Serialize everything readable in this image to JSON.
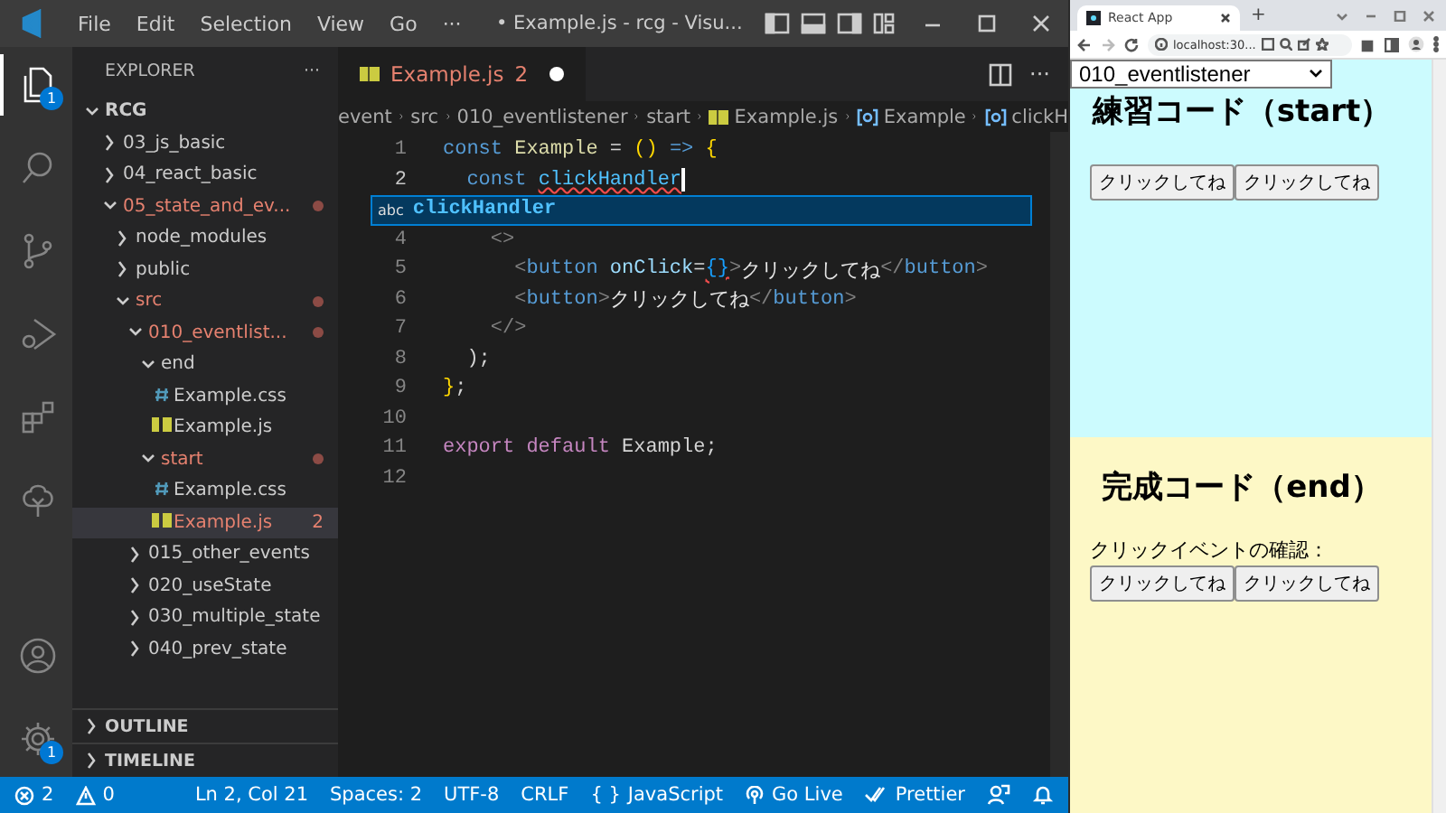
{
  "titlebar": {
    "menu": [
      "File",
      "Edit",
      "Selection",
      "View",
      "Go",
      "···"
    ],
    "title": "• Example.js - rcg - Visu..."
  },
  "activity_bar": {
    "top": [
      {
        "kind": "files",
        "badge": "1",
        "selected": true
      },
      {
        "kind": "search",
        "selected": false
      },
      {
        "kind": "source-control",
        "selected": false
      },
      {
        "kind": "run-debug",
        "selected": false
      },
      {
        "kind": "extensions",
        "selected": false
      },
      {
        "kind": "tree",
        "selected": false
      }
    ],
    "bottom": [
      {
        "kind": "account"
      },
      {
        "kind": "settings",
        "badge": "1"
      }
    ]
  },
  "sidebar": {
    "title": "EXPLORER",
    "more": "···",
    "root": {
      "label": "RCG",
      "expanded": true,
      "children": [
        {
          "label": "03_js_basic",
          "kind": "folder",
          "expanded": false,
          "modified": false,
          "selected": false
        },
        {
          "label": "04_react_basic",
          "kind": "folder",
          "expanded": false,
          "modified": false,
          "selected": false
        },
        {
          "label": "05_state_and_ev...",
          "kind": "folder",
          "expanded": true,
          "modified": true,
          "selected": false,
          "children": [
            {
              "label": "node_modules",
              "kind": "folder",
              "expanded": false,
              "modified": false,
              "selected": false
            },
            {
              "label": "public",
              "kind": "folder",
              "expanded": false,
              "modified": false,
              "selected": false
            },
            {
              "label": "src",
              "kind": "folder",
              "expanded": true,
              "modified": true,
              "selected": false,
              "children": [
                {
                  "label": "010_eventlist...",
                  "kind": "folder",
                  "expanded": true,
                  "modified": true,
                  "selected": false,
                  "children": [
                    {
                      "label": "end",
                      "kind": "folder",
                      "expanded": true,
                      "modified": false,
                      "selected": false,
                      "children": [
                        {
                          "label": "Example.css",
                          "kind": "css",
                          "modified": false,
                          "selected": false
                        },
                        {
                          "label": "Example.js",
                          "kind": "js",
                          "modified": false,
                          "selected": false
                        }
                      ]
                    },
                    {
                      "label": "start",
                      "kind": "folder",
                      "expanded": true,
                      "modified": true,
                      "selected": false,
                      "children": [
                        {
                          "label": "Example.css",
                          "kind": "css",
                          "modified": false,
                          "selected": false
                        },
                        {
                          "label": "Example.js",
                          "kind": "js",
                          "modified": true,
                          "selected": true,
                          "badge": "2"
                        }
                      ]
                    }
                  ]
                },
                {
                  "label": "015_other_events",
                  "kind": "folder",
                  "expanded": false,
                  "modified": false,
                  "selected": false
                },
                {
                  "label": "020_useState",
                  "kind": "folder",
                  "expanded": false,
                  "modified": false,
                  "selected": false
                },
                {
                  "label": "030_multiple_state",
                  "kind": "folder",
                  "expanded": false,
                  "modified": false,
                  "selected": false
                },
                {
                  "label": "040_prev_state",
                  "kind": "folder",
                  "expanded": false,
                  "modified": false,
                  "selected": false
                }
              ]
            }
          ]
        }
      ]
    },
    "sections": [
      {
        "label": "OUTLINE",
        "expanded": false
      },
      {
        "label": "TIMELINE",
        "expanded": false
      }
    ]
  },
  "editor": {
    "tabs": [
      {
        "label": "Example.js",
        "kind": "js",
        "problems": "2",
        "dirty": true,
        "selected": true
      }
    ],
    "more": "···",
    "breadcrumb": [
      {
        "label": "event",
        "kind": "folder"
      },
      {
        "label": "src",
        "kind": "folder"
      },
      {
        "label": "010_eventlistener",
        "kind": "folder"
      },
      {
        "label": "start",
        "kind": "folder"
      },
      {
        "label": "Example.js",
        "kind": "js"
      },
      {
        "label": "Example",
        "kind": "symbol"
      },
      {
        "label": "clickH",
        "kind": "symbol"
      }
    ],
    "lines": [
      {
        "number": "1",
        "current": false,
        "tokens": [
          {
            "text": "const ",
            "kind": "kw"
          },
          {
            "text": "Example",
            "kind": "fn"
          },
          {
            "text": " = ",
            "kind": "op"
          },
          {
            "text": "()",
            "kind": "brace"
          },
          {
            "text": " => ",
            "kind": "kw"
          },
          {
            "text": "{",
            "kind": "brace"
          }
        ]
      },
      {
        "number": "2",
        "current": true,
        "cursor": true,
        "tokens": [
          {
            "text": "  const ",
            "kind": "kw"
          },
          {
            "text": "clickHandler",
            "kind": "var",
            "error": true
          }
        ]
      },
      {
        "number": "4",
        "current": false,
        "tokens": [
          {
            "text": "    <>",
            "kind": "punct"
          }
        ]
      },
      {
        "number": "5",
        "current": false,
        "tokens": [
          {
            "text": "      <",
            "kind": "punct"
          },
          {
            "text": "button",
            "kind": "kw"
          },
          {
            "text": " onClick",
            "kind": "attr"
          },
          {
            "text": "=",
            "kind": "op"
          },
          {
            "text": "{}",
            "kind": "jsx",
            "error": true
          },
          {
            "text": ">",
            "kind": "punct"
          },
          {
            "text": "クリックしてね",
            "kind": "text"
          },
          {
            "text": "</",
            "kind": "punct"
          },
          {
            "text": "button",
            "kind": "kw"
          },
          {
            "text": ">",
            "kind": "punct"
          }
        ]
      },
      {
        "number": "6",
        "current": false,
        "tokens": [
          {
            "text": "      <",
            "kind": "punct"
          },
          {
            "text": "button",
            "kind": "kw"
          },
          {
            "text": ">",
            "kind": "punct"
          },
          {
            "text": "クリックしてね",
            "kind": "text"
          },
          {
            "text": "</",
            "kind": "punct"
          },
          {
            "text": "button",
            "kind": "kw"
          },
          {
            "text": ">",
            "kind": "punct"
          }
        ]
      },
      {
        "number": "7",
        "current": false,
        "tokens": [
          {
            "text": "    </>",
            "kind": "punct"
          }
        ]
      },
      {
        "number": "8",
        "current": false,
        "tokens": [
          {
            "text": "  );",
            "kind": "op"
          }
        ]
      },
      {
        "number": "9",
        "current": false,
        "tokens": [
          {
            "text": "}",
            "kind": "brace"
          },
          {
            "text": ";",
            "kind": "op"
          }
        ]
      },
      {
        "number": "10",
        "current": false
      },
      {
        "number": "11",
        "current": false,
        "tokens": [
          {
            "text": "export default ",
            "kind": "kw2"
          },
          {
            "text": "Example",
            "kind": "plain"
          },
          {
            "text": ";",
            "kind": "op"
          }
        ]
      },
      {
        "number": "12",
        "current": false
      }
    ],
    "suggestion": {
      "icon": "abc",
      "label": "clickHandler"
    }
  },
  "status_bar": [
    {
      "kind": "errors",
      "text": "2"
    },
    {
      "kind": "warnings",
      "text": "0"
    },
    {
      "kind": "spacer"
    },
    {
      "kind": "text",
      "text": "Ln 2, Col 21"
    },
    {
      "kind": "text",
      "text": "Spaces: 2"
    },
    {
      "kind": "text",
      "text": "UTF-8"
    },
    {
      "kind": "text",
      "text": "CRLF"
    },
    {
      "kind": "language",
      "glyph": "{ }",
      "text": "JavaScript"
    },
    {
      "kind": "golive",
      "text": "Go Live"
    },
    {
      "kind": "prettier",
      "text": "Prettier"
    },
    {
      "kind": "feedback"
    },
    {
      "kind": "bell"
    }
  ],
  "browser": {
    "tab": "React App",
    "new_tab": "+",
    "address": "localhost:30...",
    "select": "010_eventlistener",
    "sections": [
      {
        "heading": "練習コード（start）",
        "color": "#ccfbfe",
        "buttons": [
          "クリックしてね",
          "クリックしてね"
        ]
      },
      {
        "heading": "完成コード（end）",
        "color": "#fdf8c6",
        "label": "クリックイベントの確認：",
        "buttons": [
          "クリックしてね",
          "クリックしてね"
        ]
      }
    ]
  }
}
